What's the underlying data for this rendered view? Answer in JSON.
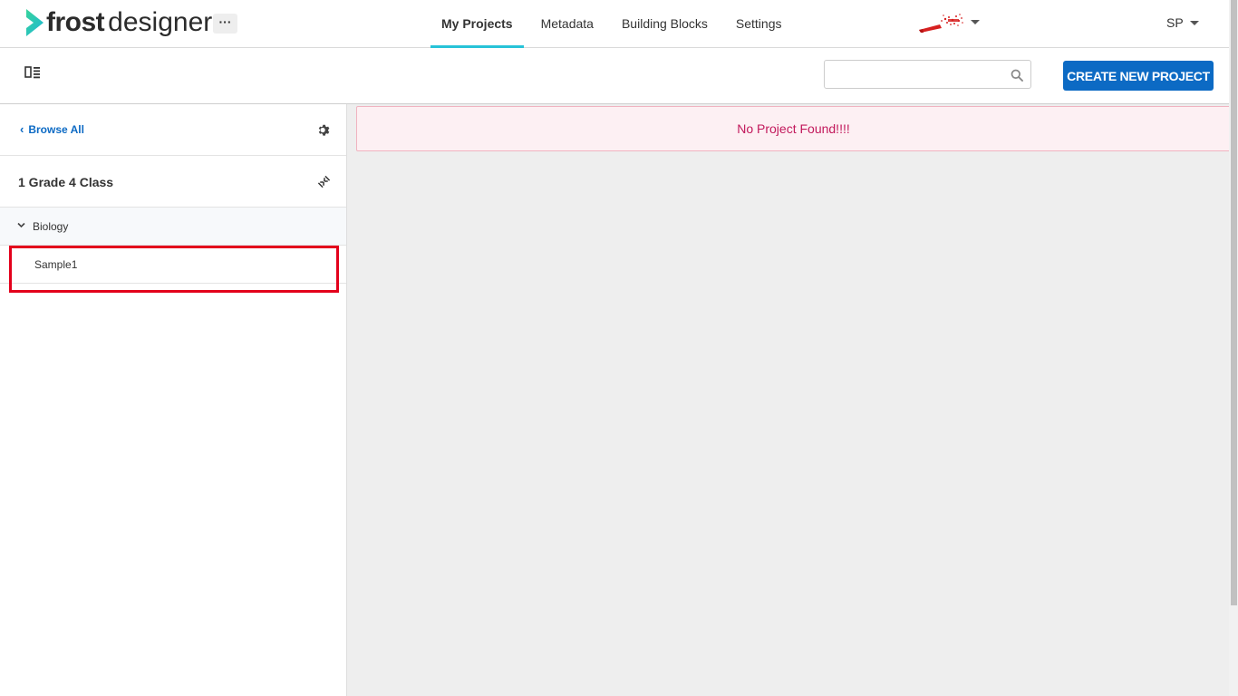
{
  "app": {
    "brand_bold": "frost",
    "brand_light": "designer",
    "more_label": "···"
  },
  "nav": {
    "tabs": [
      {
        "label": "My Projects",
        "active": true
      },
      {
        "label": "Metadata",
        "active": false
      },
      {
        "label": "Building Blocks",
        "active": false
      },
      {
        "label": "Settings",
        "active": false
      }
    ]
  },
  "user": {
    "initials": "SP"
  },
  "toolbar": {
    "search_value": "",
    "search_placeholder": "",
    "create_label": "CREATE NEW PROJECT"
  },
  "sidebar": {
    "browse_all_label": "Browse All",
    "class_title": "1 Grade 4 Class",
    "subject_label": "Biology",
    "items": [
      {
        "label": "Sample1"
      }
    ]
  },
  "main": {
    "alert_text": "No Project Found!!!!"
  },
  "colors": {
    "accent": "#0c6ac4",
    "tab_underline": "#27c3d8",
    "logo_chevron": "#1fd6a6",
    "alert_text": "#c2185b",
    "highlight": "#e3001b"
  }
}
